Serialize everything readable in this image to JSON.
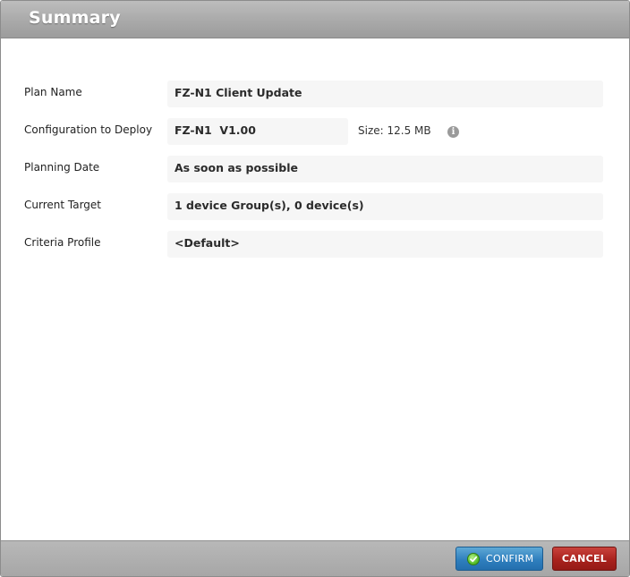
{
  "dialog": {
    "title": "Summary"
  },
  "summary": {
    "plan_name": {
      "label": "Plan Name",
      "value": "FZ-N1 Client Update"
    },
    "configuration": {
      "label": "Configuration to Deploy",
      "value": "FZ-N1  V1.00",
      "size_label": "Size: 12.5 MB",
      "info_icon": "info-icon"
    },
    "planning_date": {
      "label": "Planning Date",
      "value": "As soon as possible"
    },
    "current_target": {
      "label": "Current Target",
      "value": "1 device Group(s), 0 device(s)"
    },
    "criteria_profile": {
      "label": "Criteria Profile",
      "value": "<Default>"
    }
  },
  "footer": {
    "confirm_label": "CONFIRM",
    "confirm_icon": "check-icon",
    "cancel_label": "CANCEL"
  },
  "colors": {
    "confirm": "#2f7fbe",
    "cancel": "#a9221d",
    "titlebar": "#a9a9a9",
    "value_bg": "#f6f6f6"
  }
}
